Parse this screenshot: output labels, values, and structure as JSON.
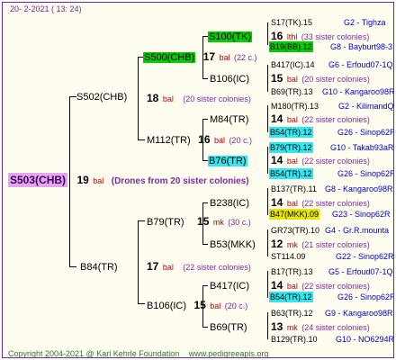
{
  "header": {
    "date": "20-  2-2021 ( 13: 24)"
  },
  "root": {
    "name": "S503(CHB)",
    "gen": "19",
    "bal": "bal",
    "drones": "(Drones from 20 sister colonies)"
  },
  "mid": [
    {
      "name": "S502(CHB)",
      "gen": "18",
      "bal": "bal",
      "sis": "(20 sister colonies)"
    },
    {
      "name": "B84(TR)",
      "gen": "17",
      "bal": "bal",
      "sis": "(22 sister colonies)"
    }
  ],
  "gp": [
    {
      "name": "S500(CHB)",
      "gen": "17",
      "bal": "bal",
      "sis": "(22 c.)"
    },
    {
      "name": "M112(TR)",
      "gen": "16",
      "bal": "bal",
      "sis": "(20 c.)"
    },
    {
      "name": "B79(TR)",
      "gen": "15",
      "bal": "mk",
      "sis": "(30 c.)"
    },
    {
      "name": "B106(IC)",
      "gen": "15",
      "bal": "bal",
      "sis": "(20 c.)"
    }
  ],
  "ggp": [
    {
      "name": "S100(TK)",
      "gen": "16",
      "bal": "lthl",
      "sis": "(33 sister colonies)"
    },
    {
      "name": "B106(IC)",
      "gen": "15",
      "bal": "bal",
      "sis": "(20 sister colonies)"
    },
    {
      "name": "M84(TR)",
      "gen": "14",
      "bal": "bal",
      "sis": "(22 sister colonies)"
    },
    {
      "name": "B76(TR)",
      "gen": "14",
      "bal": "bal",
      "sis": "(22 sister colonies)"
    },
    {
      "name": "B238(IC)",
      "gen": "14",
      "bal": "bal",
      "sis": "(22 sister colonies)"
    },
    {
      "name": "B53(MKK)",
      "gen": "12",
      "bal": "mk",
      "sis": "(21 sister colonies)"
    },
    {
      "name": "B417(IC)",
      "gen": "14",
      "bal": "bal",
      "sis": "(22 sister colonies)"
    },
    {
      "name": "B69(TR)",
      "gen": "13",
      "bal": "mk",
      "sis": "(24 sister colonies)"
    }
  ],
  "right": [
    {
      "name": "S17(TK).15",
      "where": "G2 - Tighza"
    },
    {
      "name": "B19(BB).12",
      "where": "G8 - Bayburt98-3"
    },
    {
      "name": "B417(IC).14",
      "where": "G6 - Erfoud07-1Q"
    },
    {
      "name": "B69(TR).13",
      "where": "G10 - Kangaroo98R"
    },
    {
      "name": "M180(TR).13",
      "where": "G2 - KilimandQ"
    },
    {
      "name": "B54(TR).12",
      "where": "G26 - Sinop62R"
    },
    {
      "name": "B79(TR).12",
      "where": "G10 - Takab93aR"
    },
    {
      "name": "B54(TR).12",
      "where": "G26 - Sinop62R"
    },
    {
      "name": "B137(TR).11",
      "where": "G8 - Kangaroo98R"
    },
    {
      "name": "B47(MKK).09",
      "where": "G23 - Sinop62R"
    },
    {
      "name": "GR73(TR).10",
      "where": "G4 - Gr.R.mounta"
    },
    {
      "name": "ST114.09",
      "where": "G22 - Sinop62R"
    },
    {
      "name": "B17(TR).13",
      "where": "G5 - Erfoud07-1Q"
    },
    {
      "name": "B54(TR).12",
      "where": "G26 - Sinop62R"
    },
    {
      "name": "B63(TR).12",
      "where": "G9 - Kangaroo98R"
    },
    {
      "name": "B129(TR).10",
      "where": "G10 - NO6294R"
    }
  ],
  "footer": {
    "copyright": "Copyright 2004-2021 @ Karl Kehrle Foundation",
    "site": "www.pedigreeapis.org"
  }
}
